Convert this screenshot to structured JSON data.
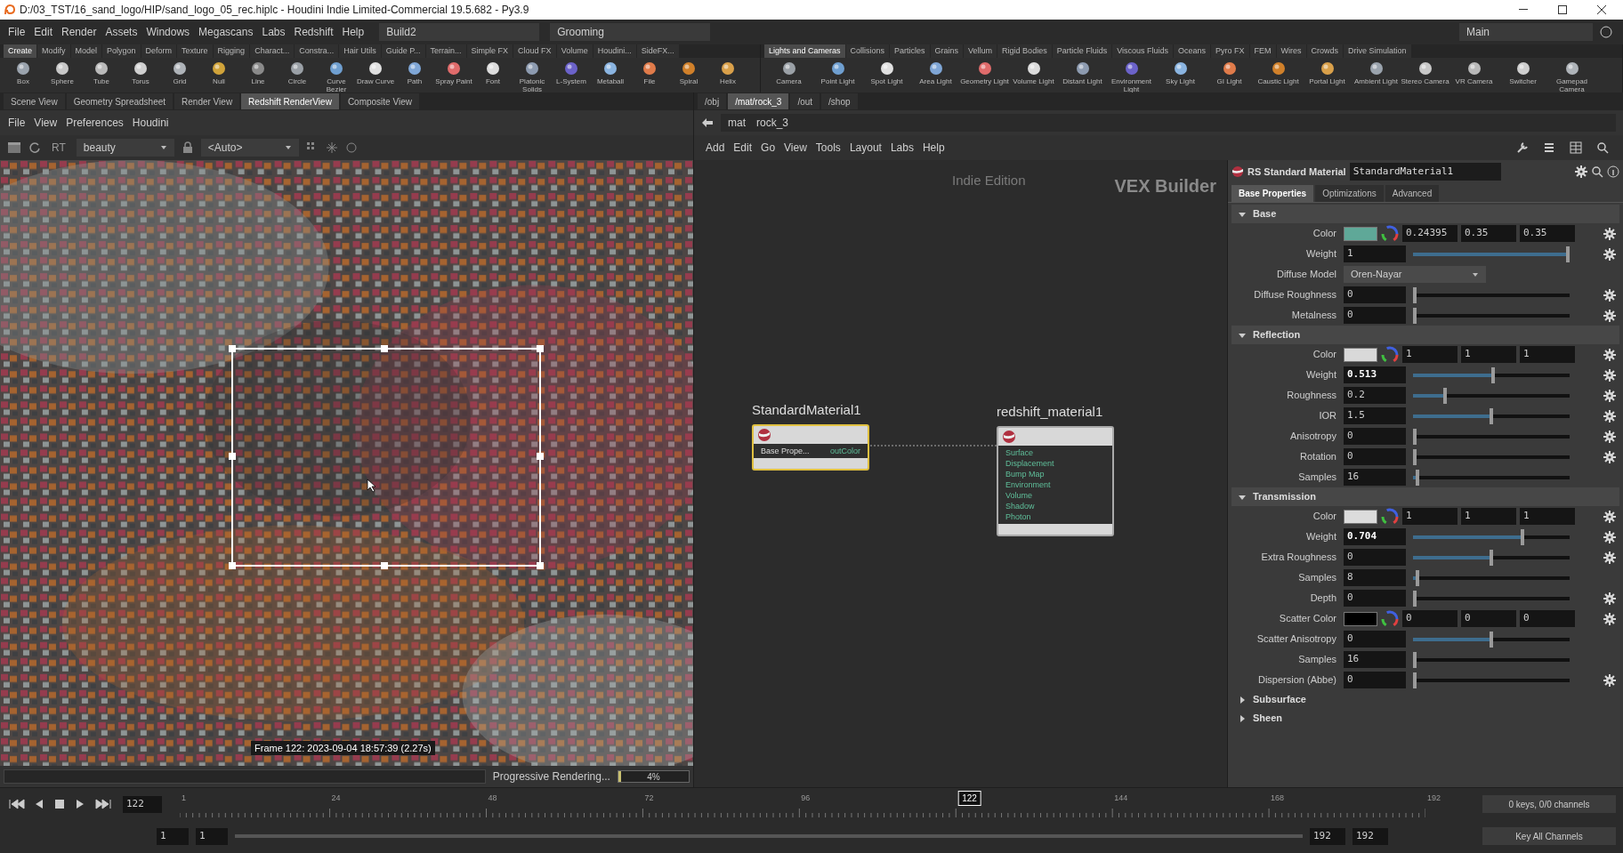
{
  "window": {
    "title": "D:/03_TST/16_sand_logo/HIP/sand_logo_05_rec.hiplc - Houdini Indie Limited-Commercial 19.5.682 - Py3.9"
  },
  "menu_bar": [
    "File",
    "Edit",
    "Render",
    "Assets",
    "Windows",
    "Megascans",
    "Labs",
    "Redshift",
    "Help"
  ],
  "desktops": [
    "Build2",
    "Grooming"
  ],
  "workspace": "Main",
  "shelf_left": {
    "tabs": [
      {
        "label": "Create",
        "selected": true
      },
      {
        "label": "Modify",
        "selected": false
      },
      {
        "label": "Model",
        "selected": false
      },
      {
        "label": "Polygon",
        "selected": false
      },
      {
        "label": "Deform",
        "selected": false
      },
      {
        "label": "Texture",
        "selected": false
      },
      {
        "label": "Rigging",
        "selected": false
      },
      {
        "label": "Charact...",
        "selected": false
      },
      {
        "label": "Constra...",
        "selected": false
      },
      {
        "label": "Hair Utils",
        "selected": false
      },
      {
        "label": "Guide P...",
        "selected": false
      },
      {
        "label": "Terrain...",
        "selected": false
      },
      {
        "label": "Simple FX",
        "selected": false
      },
      {
        "label": "Cloud FX",
        "selected": false
      },
      {
        "label": "Volume",
        "selected": false
      },
      {
        "label": "Houdini...",
        "selected": false
      },
      {
        "label": "SideFX...",
        "selected": false
      }
    ],
    "tools": [
      "Box",
      "Sphere",
      "Tube",
      "Torus",
      "Grid",
      "Null",
      "Line",
      "Circle",
      "Curve Bezier",
      "Draw Curve",
      "Path",
      "Spray Paint",
      "Font",
      "Platonic Solids",
      "L-System",
      "Metaball",
      "File",
      "Spiral",
      "Helix"
    ]
  },
  "shelf_right": {
    "tabs": [
      {
        "label": "Lights and Cameras",
        "selected": true
      },
      {
        "label": "Collisions",
        "selected": false
      },
      {
        "label": "Particles",
        "selected": false
      },
      {
        "label": "Grains",
        "selected": false
      },
      {
        "label": "Vellum",
        "selected": false
      },
      {
        "label": "Rigid Bodies",
        "selected": false
      },
      {
        "label": "Particle Fluids",
        "selected": false
      },
      {
        "label": "Viscous Fluids",
        "selected": false
      },
      {
        "label": "Oceans",
        "selected": false
      },
      {
        "label": "Pyro FX",
        "selected": false
      },
      {
        "label": "FEM",
        "selected": false
      },
      {
        "label": "Wires",
        "selected": false
      },
      {
        "label": "Crowds",
        "selected": false
      },
      {
        "label": "Drive Simulation",
        "selected": false
      }
    ],
    "tools": [
      "Camera",
      "Point Light",
      "Spot Light",
      "Area Light",
      "Geometry Light",
      "Volume Light",
      "Distant Light",
      "Environment Light",
      "Sky Light",
      "GI Light",
      "Caustic Light",
      "Portal Light",
      "Ambient Light",
      "Stereo Camera",
      "VR Camera",
      "Switcher",
      "Gamepad Camera"
    ]
  },
  "viewer": {
    "tabs": [
      {
        "label": "Scene View",
        "selected": false
      },
      {
        "label": "Geometry Spreadsheet",
        "selected": false
      },
      {
        "label": "Render View",
        "selected": false
      },
      {
        "label": "Redshift RenderView",
        "selected": true
      },
      {
        "label": "Composite View",
        "selected": false
      }
    ],
    "menu": [
      "File",
      "View",
      "Preferences",
      "Houdini"
    ],
    "rt": "RT",
    "aov": "beauty",
    "camera": "<Auto>",
    "frame_caption": "Frame 122: 2023-09-04 18:57:39 (2.27s)",
    "progress": {
      "label": "Progressive Rendering...",
      "reading": "4%",
      "level": 0.04
    }
  },
  "network": {
    "tabs": [
      {
        "label": "/obj",
        "selected": false
      },
      {
        "label": "/mat/rock_3",
        "selected": true
      },
      {
        "label": "/out",
        "selected": false
      },
      {
        "label": "/shop",
        "selected": false
      }
    ],
    "path": [
      "mat",
      "rock_3"
    ],
    "menu": [
      "Add",
      "Edit",
      "Go",
      "View",
      "Tools",
      "Layout",
      "Labs",
      "Help"
    ],
    "edition": "Indie Edition",
    "context": "VEX Builder",
    "nodes": [
      {
        "name": "StandardMaterial1",
        "selected": true,
        "inputs": [
          "Base Prope..."
        ],
        "outputs": [
          "outColor"
        ]
      },
      {
        "name": "redshift_material1",
        "selected": false,
        "inputs": [
          "Surface",
          "Displacement",
          "Bump Map",
          "Environment",
          "Volume",
          "Shadow",
          "Photon"
        ]
      }
    ]
  },
  "parameters": {
    "type": "RS Standard Material",
    "name": "StandardMaterial1",
    "tabs": [
      {
        "label": "Base Properties",
        "selected": true
      },
      {
        "label": "Optimizations",
        "selected": false
      },
      {
        "label": "Advanced",
        "selected": false
      }
    ],
    "sections": [
      {
        "title": "Base",
        "expanded": true,
        "params": [
          {
            "kind": "color",
            "label": "Color",
            "color": "#5fa898",
            "values": [
              "0.24395",
              "0.35",
              "0.35"
            ],
            "gear": true
          },
          {
            "kind": "slider",
            "label": "Weight",
            "value": "1",
            "level": 1,
            "modified": false,
            "gear": true
          },
          {
            "kind": "menu",
            "label": "Diffuse Model",
            "value": "Oren-Nayar"
          },
          {
            "kind": "slider",
            "label": "Diffuse Roughness",
            "value": "0",
            "level": 0,
            "modified": false,
            "gear": true
          },
          {
            "kind": "slider",
            "label": "Metalness",
            "value": "0",
            "level": 0,
            "modified": false,
            "gear": true
          }
        ]
      },
      {
        "title": "Reflection",
        "expanded": true,
        "params": [
          {
            "kind": "color",
            "label": "Color",
            "color": "#d9d9d9",
            "values": [
              "1",
              "1",
              "1"
            ],
            "gear": true
          },
          {
            "kind": "slider",
            "label": "Weight",
            "value": "0.513",
            "level": 0.513,
            "modified": true,
            "gear": true
          },
          {
            "kind": "slider",
            "label": "Roughness",
            "value": "0.2",
            "level": 0.2,
            "modified": false,
            "gear": true
          },
          {
            "kind": "slider",
            "label": "IOR",
            "value": "1.5",
            "level": 0.5,
            "modified": false,
            "gear": true
          },
          {
            "kind": "slider",
            "label": "Anisotropy",
            "value": "0",
            "level": 0,
            "modified": false,
            "gear": true
          },
          {
            "kind": "slider",
            "label": "Rotation",
            "value": "0",
            "level": 0,
            "modified": false,
            "gear": true
          },
          {
            "kind": "slider",
            "label": "Samples",
            "value": "16",
            "level": 0.02,
            "modified": false,
            "gear": false
          }
        ]
      },
      {
        "title": "Transmission",
        "expanded": true,
        "params": [
          {
            "kind": "color",
            "label": "Color",
            "color": "#dcdcdc",
            "values": [
              "1",
              "1",
              "1"
            ],
            "gear": true
          },
          {
            "kind": "slider",
            "label": "Weight",
            "value": "0.704",
            "level": 0.704,
            "modified": true,
            "gear": true
          },
          {
            "kind": "slider",
            "label": "Extra Roughness",
            "value": "0",
            "level": 0.5,
            "modified": false,
            "gear": true
          },
          {
            "kind": "slider",
            "label": "Samples",
            "value": "8",
            "level": 0.015,
            "modified": false,
            "gear": false
          },
          {
            "kind": "slider",
            "label": "Depth",
            "value": "0",
            "level": 0,
            "modified": false,
            "gear": true
          },
          {
            "kind": "color",
            "label": "Scatter Color",
            "color": "#000000",
            "values": [
              "0",
              "0",
              "0"
            ],
            "gear": true
          },
          {
            "kind": "slider",
            "label": "Scatter Anisotropy",
            "value": "0",
            "level": 0.5,
            "modified": false,
            "gear": false
          },
          {
            "kind": "slider",
            "label": "Samples",
            "value": "16",
            "level": 0,
            "modified": false,
            "gear": false
          },
          {
            "kind": "slider",
            "label": "Dispersion (Abbe)",
            "value": "0",
            "level": 0,
            "modified": false,
            "gear": true
          }
        ]
      },
      {
        "title": "Subsurface",
        "expanded": false
      },
      {
        "title": "Sheen",
        "expanded": false
      }
    ]
  },
  "timeline": {
    "frame": "122",
    "ticks": [
      "1",
      "24",
      "48",
      "72",
      "96",
      "144",
      "168",
      "192"
    ],
    "playhead": {
      "label": "122",
      "level": 0.634
    },
    "range": [
      "1",
      "1",
      "192",
      "192"
    ],
    "keys_status": "0 keys, 0/0 channels",
    "key_button": "Key All Channels"
  }
}
